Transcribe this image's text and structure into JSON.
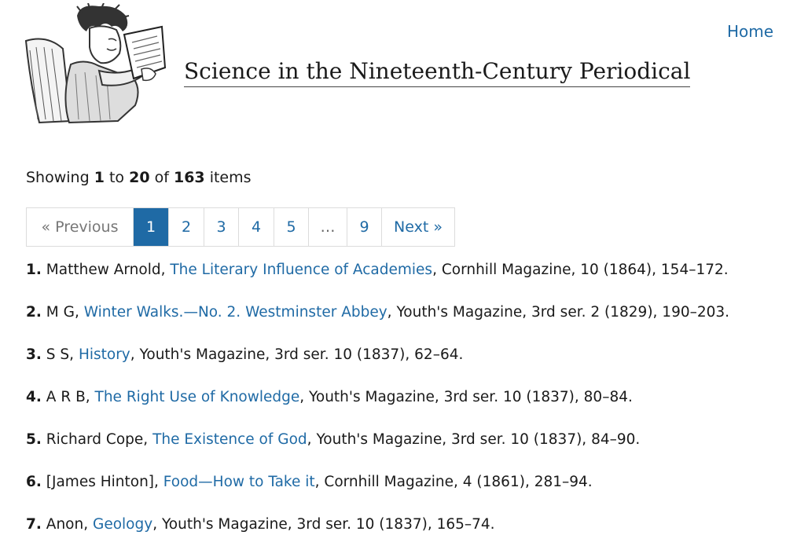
{
  "header": {
    "site_title": "Science in the Nineteenth-Century Periodical",
    "home_label": "Home",
    "logo_icon": "reading-boy-illustration"
  },
  "summary": {
    "prefix": "Showing",
    "from": "1",
    "to_word": "to",
    "to": "20",
    "of_word": "of",
    "total": "163",
    "suffix": "items"
  },
  "pagination": [
    {
      "label": "« Previous",
      "state": "disabled"
    },
    {
      "label": "1",
      "state": "active"
    },
    {
      "label": "2",
      "state": "link"
    },
    {
      "label": "3",
      "state": "link"
    },
    {
      "label": "4",
      "state": "link"
    },
    {
      "label": "5",
      "state": "link"
    },
    {
      "label": "…",
      "state": "ellipsis"
    },
    {
      "label": "9",
      "state": "link"
    },
    {
      "label": "Next »",
      "state": "link"
    }
  ],
  "items": [
    {
      "num": "1.",
      "author": "Matthew Arnold",
      "title": "The Literary Influence of Academies",
      "rest": "Cornhill Magazine, 10 (1864), 154–172."
    },
    {
      "num": "2.",
      "author": "M G",
      "title": "Winter Walks.—No. 2. Westminster Abbey",
      "rest": "Youth's Magazine, 3rd ser. 2 (1829), 190–203."
    },
    {
      "num": "3.",
      "author": "S S",
      "title": "History",
      "rest": "Youth's Magazine, 3rd ser. 10 (1837), 62–64."
    },
    {
      "num": "4.",
      "author": "A R B",
      "title": "The Right Use of Knowledge",
      "rest": "Youth's Magazine, 3rd ser. 10 (1837), 80–84."
    },
    {
      "num": "5.",
      "author": "Richard Cope",
      "title": "The Existence of God",
      "rest": "Youth's Magazine, 3rd ser. 10 (1837), 84–90."
    },
    {
      "num": "6.",
      "author": "[James Hinton]",
      "title": "Food—How to Take it",
      "rest": "Cornhill Magazine, 4 (1861), 281–94."
    },
    {
      "num": "7.",
      "author": "Anon",
      "title": "Geology",
      "rest": "Youth's Magazine, 3rd ser. 10 (1837), 165–74."
    }
  ],
  "colors": {
    "link": "#1f6aa5",
    "active_bg": "#1f6aa5",
    "text": "#1a1a1a"
  }
}
